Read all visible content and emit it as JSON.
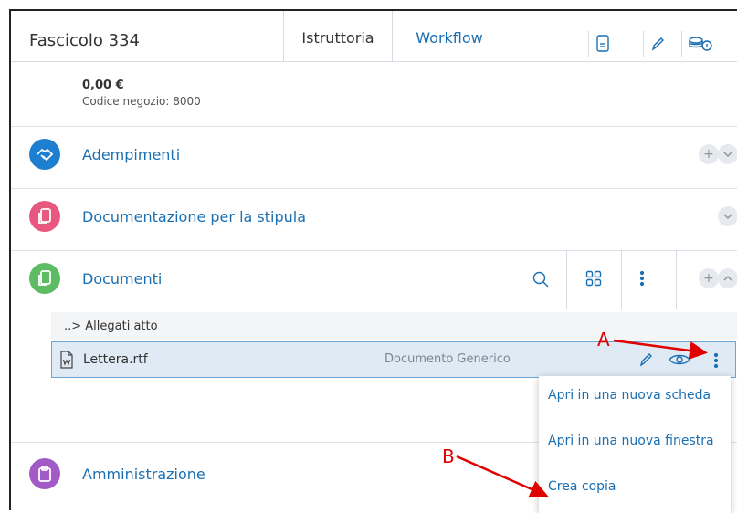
{
  "header": {
    "title": "Fascicolo 334",
    "tabs": [
      {
        "label": "Istruttoria"
      },
      {
        "label": "Workflow"
      }
    ]
  },
  "summary": {
    "amount": "0,00 €",
    "codice": "Codice negozio: 8000"
  },
  "sections": {
    "adempimenti": "Adempimenti",
    "documentazione": "Documentazione per la stipula",
    "documenti": "Documenti",
    "amministrazione": "Amministrazione"
  },
  "documents": {
    "breadcrumb": "..> Allegati atto",
    "file_name": "Lettera.rtf",
    "file_type": "Documento Generico"
  },
  "context_menu": {
    "items": [
      "Apri in una nuova scheda",
      "Apri in una nuova finestra",
      "Crea copia"
    ]
  },
  "annotations": {
    "a": "A",
    "b": "B"
  },
  "colors": {
    "accent": "#1a6fb3",
    "adempimenti": "#1e7fd0",
    "documentazione": "#e8577f",
    "documenti": "#5dbb63",
    "amministrazione": "#a25ac6",
    "annotation": "#e00000"
  }
}
